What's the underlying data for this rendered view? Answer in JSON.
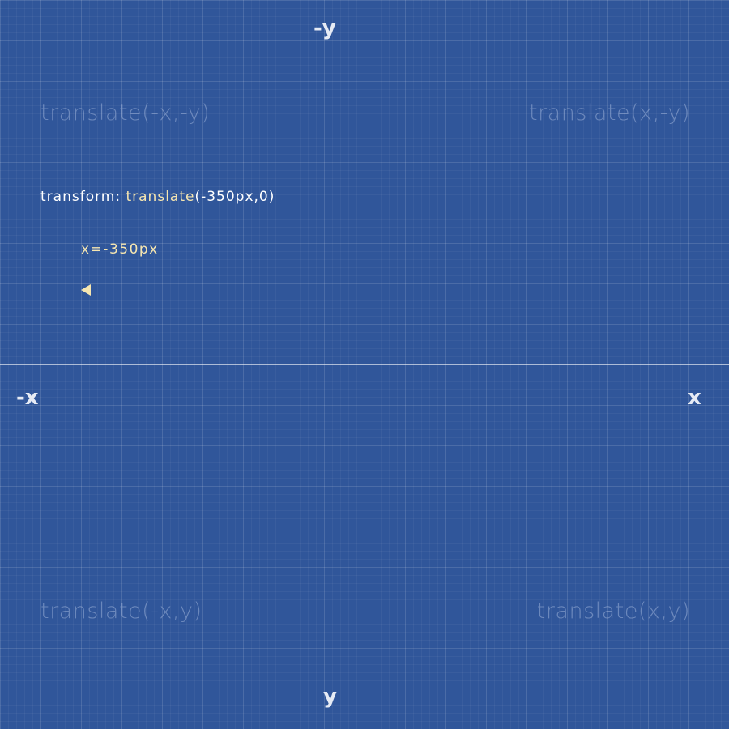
{
  "axes": {
    "neg_y": "-y",
    "pos_y": "y",
    "neg_x": "-x",
    "pos_x": "x"
  },
  "quadrants": {
    "top_left": "translate(-x,-y)",
    "top_right": "translate(x,-y)",
    "bottom_left": "translate(-x,y)",
    "bottom_right": "translate(x,y)"
  },
  "transform": {
    "property": "transform: ",
    "function": "translate",
    "args": "(-350px,0)"
  },
  "x_readout": "x=-350px",
  "colors": {
    "background": "#30569a",
    "highlight": "#f6e6b0",
    "text": "#ffffff"
  },
  "arrow": {
    "direction": "left",
    "icon": "left-arrow-icon"
  }
}
